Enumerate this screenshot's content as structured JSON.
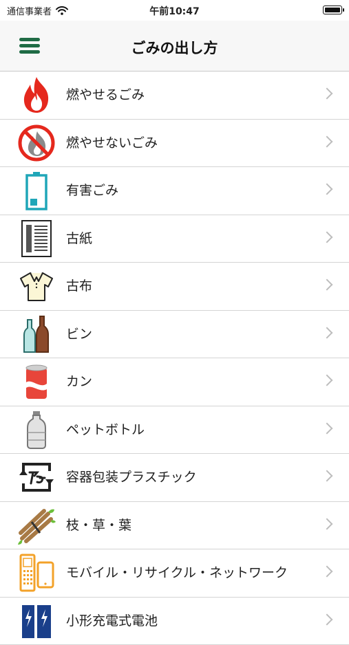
{
  "status_bar": {
    "carrier": "通信事業者",
    "time": "午前10:47",
    "battery_level": 1.0
  },
  "nav": {
    "title": "ごみの出し方",
    "menu_icon": "hamburger-menu-icon"
  },
  "items": [
    {
      "label": "燃やせるごみ",
      "icon": "fire-icon"
    },
    {
      "label": "燃やせないごみ",
      "icon": "no-burn-icon"
    },
    {
      "label": "有害ごみ",
      "icon": "battery-icon"
    },
    {
      "label": "古紙",
      "icon": "newspaper-icon"
    },
    {
      "label": "古布",
      "icon": "shirt-icon"
    },
    {
      "label": "ビン",
      "icon": "bottles-icon"
    },
    {
      "label": "カン",
      "icon": "can-icon"
    },
    {
      "label": "ペットボトル",
      "icon": "pet-bottle-icon"
    },
    {
      "label": "容器包装プラスチック",
      "icon": "plastic-recycle-icon"
    },
    {
      "label": "枝・草・葉",
      "icon": "branches-icon"
    },
    {
      "label": "モバイル・リサイクル・ネットワーク",
      "icon": "mobile-phone-icon"
    },
    {
      "label": "小形充電式電池",
      "icon": "rechargeable-battery-icon"
    }
  ],
  "colors": {
    "accent": "#1f6b45",
    "fire": "#e5281d",
    "teal": "#1fa6b8",
    "orange": "#f3a229"
  }
}
